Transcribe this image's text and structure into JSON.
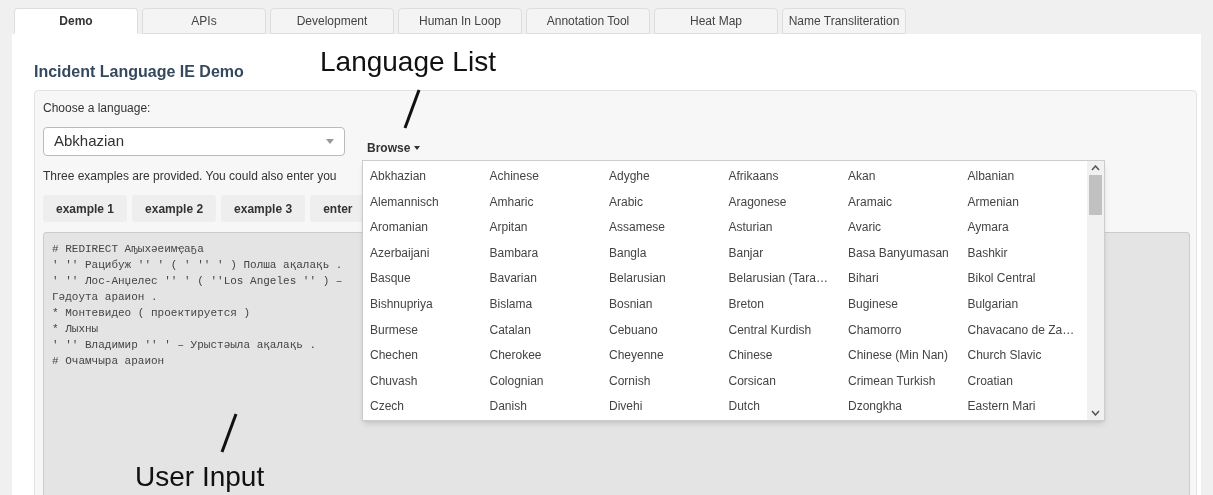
{
  "tabs": [
    {
      "label": "Demo",
      "selected": true
    },
    {
      "label": "APIs",
      "selected": false
    },
    {
      "label": "Development",
      "selected": false
    },
    {
      "label": "Human In Loop",
      "selected": false
    },
    {
      "label": "Annotation Tool",
      "selected": false
    },
    {
      "label": "Heat Map",
      "selected": false
    },
    {
      "label": "Name Transliteration",
      "selected": false
    }
  ],
  "heading": "Incident Language IE Demo",
  "form": {
    "label": "Choose a language:",
    "select_value": "Abkhazian",
    "browse": "Browse",
    "intro": "Three examples are provided. You could also enter you",
    "buttons": [
      "example 1",
      "example 2",
      "example 3",
      "enter"
    ],
    "input_value": "# REDIRECT Аҧыхәеимҿаҕа\n' '' Рацибуж '' ' ( ' '' ' ) Полша ақалақь .\n' '' Лос-Анџелес '' ' ( ''Los Angeles '' ) –\nГәдоута араион .\n* Монтевидео ( проектируется )\n* Лыхны\n' '' Владимир '' ' – Урыстәыла ақалақь .\n# Очамчыра араион"
  },
  "language_menu": {
    "expanded": true,
    "items": [
      "Abkhazian",
      "Achinese",
      "Adyghe",
      "Afrikaans",
      "Akan",
      "Albanian",
      "Alemannisch",
      "Amharic",
      "Arabic",
      "Aragonese",
      "Aramaic",
      "Armenian",
      "Aromanian",
      "Arpitan",
      "Assamese",
      "Asturian",
      "Avaric",
      "Aymara",
      "Azerbaijani",
      "Bambara",
      "Bangla",
      "Banjar",
      "Basa Banyumasan",
      "Bashkir",
      "Basque",
      "Bavarian",
      "Belarusian",
      "Belarusian (Tara…",
      "Bihari",
      "Bikol Central",
      "Bishnupriya",
      "Bislama",
      "Bosnian",
      "Breton",
      "Buginese",
      "Bulgarian",
      "Burmese",
      "Catalan",
      "Cebuano",
      "Central Kurdish",
      "Chamorro",
      "Chavacano de Za…",
      "Chechen",
      "Cherokee",
      "Cheyenne",
      "Chinese",
      "Chinese (Min Nan)",
      "Church Slavic",
      "Chuvash",
      "Colognian",
      "Cornish",
      "Corsican",
      "Crimean Turkish",
      "Croatian",
      "Czech",
      "Danish",
      "Divehi",
      "Dutch",
      "Dzongkha",
      "Eastern Mari"
    ]
  },
  "annotations": [
    "Language List",
    "User Input"
  ]
}
